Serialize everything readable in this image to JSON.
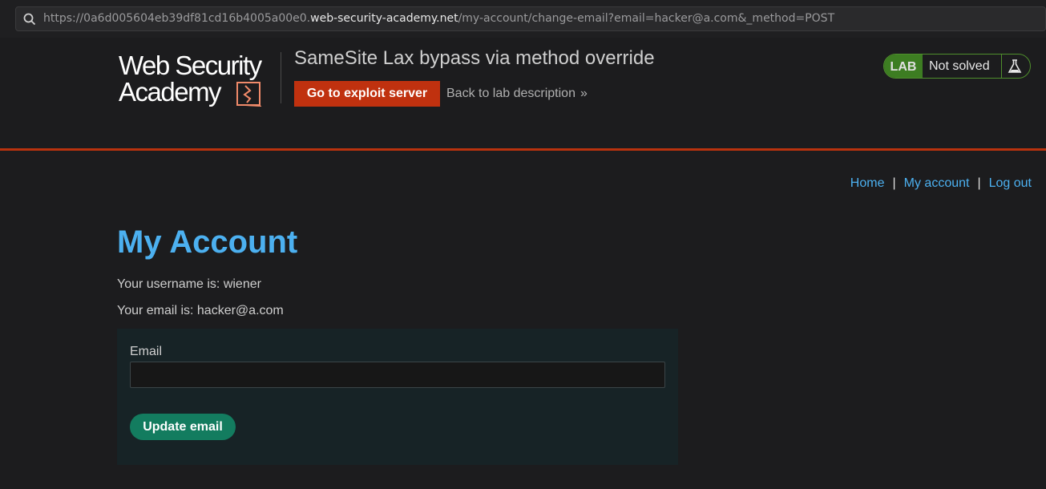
{
  "browser": {
    "url_prefix": "https://0a6d005604eb39df81cd16b4005a00e0.",
    "url_domain": "web-security-academy.net",
    "url_suffix": "/my-account/change-email?email=hacker@a.com&_method=POST"
  },
  "header": {
    "logo_line1": "Web Security",
    "logo_line2": "Academy",
    "lab_title": "SameSite Lax bypass via method override",
    "exploit_button": "Go to exploit server",
    "back_link": "Back to lab description",
    "back_chevron": "»",
    "badge_lab": "LAB",
    "badge_status": "Not solved"
  },
  "nav": {
    "home": "Home",
    "separator": "|",
    "my_account": "My account",
    "log_out": "Log out"
  },
  "main": {
    "title": "My Account",
    "username_text": "Your username is: wiener",
    "email_text": "Your email is: hacker@a.com",
    "form": {
      "email_label": "Email",
      "email_value": "",
      "submit_label": "Update email"
    }
  },
  "colors": {
    "accent_blue": "#4cb0f0",
    "exploit_red": "#c0310f",
    "lab_green": "#3d7d22",
    "update_green": "#137c5f",
    "header_rule": "#b9320e"
  },
  "icons": {
    "address_search": "search-icon",
    "logo_mark": "academy-logo-icon",
    "back_chevron": "chevron-double-right-icon",
    "badge_flask": "flask-icon"
  }
}
